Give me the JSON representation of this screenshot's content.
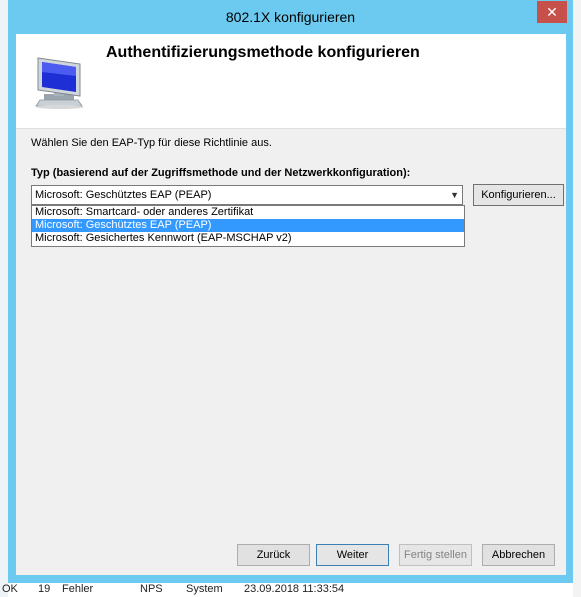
{
  "dialog": {
    "title": "802.1X konfigurieren",
    "close_label": "✕",
    "header_title": "Authentifizierungsmethode konfigurieren",
    "instruction": "Wählen Sie den EAP-Typ für diese Richtlinie aus.",
    "type_label": "Typ (basierend auf der Zugriffsmethode und der Netzwerkkonfiguration):",
    "eap_select": {
      "selected": "Microsoft: Geschütztes EAP (PEAP)",
      "options": [
        "Microsoft: Smartcard- oder anderes Zertifikat",
        "Microsoft: Geschütztes EAP (PEAP)",
        "Microsoft: Gesichertes Kennwort (EAP-MSCHAP v2)"
      ],
      "highlighted_index": 1
    },
    "configure_label": "Konfigurieren...",
    "buttons": {
      "back": "Zurück",
      "next": "Weiter",
      "finish": "Fertig stellen",
      "cancel": "Abbrechen"
    }
  },
  "background": {
    "status_row": [
      "OK",
      "19",
      "Fehler",
      "NPS",
      "System",
      "23.09.2018 11:33:54"
    ]
  },
  "colors": {
    "titlebar": "#6ccaf0",
    "close": "#c7504b",
    "selection": "#3399ff"
  }
}
